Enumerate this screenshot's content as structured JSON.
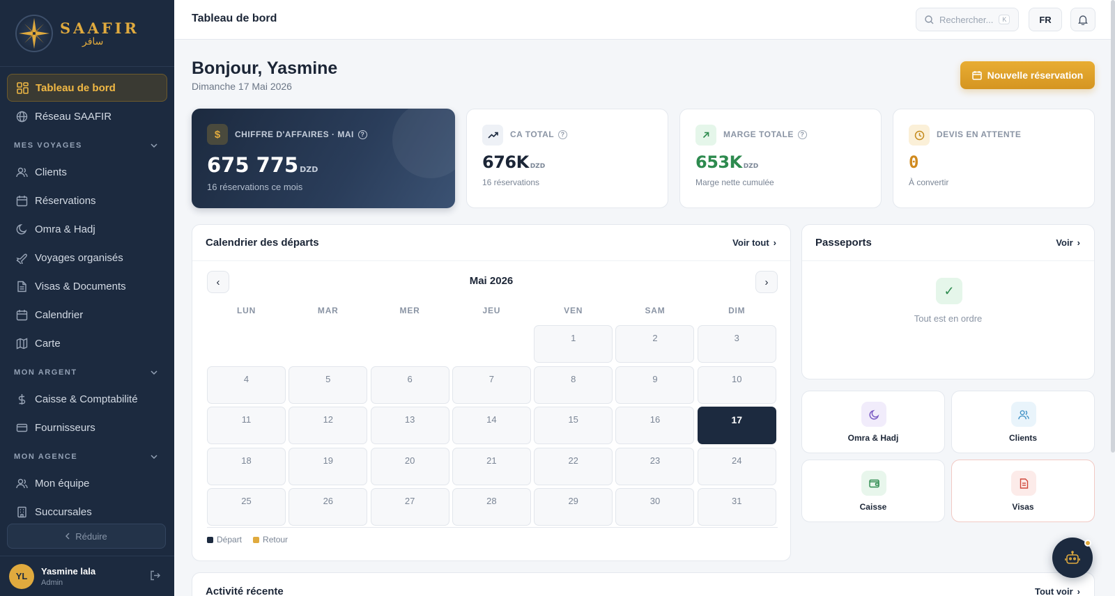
{
  "brand": {
    "name": "SAAFIR",
    "arabic": "سافر"
  },
  "sidebar": {
    "top_items": [
      {
        "label": "Tableau de bord",
        "icon": "dashboard-grid-icon",
        "active": true
      },
      {
        "label": "Réseau SAAFIR",
        "icon": "globe-icon"
      }
    ],
    "sections": [
      {
        "title": "MES VOYAGES",
        "items": [
          {
            "label": "Clients",
            "icon": "users-icon"
          },
          {
            "label": "Réservations",
            "icon": "calendar-icon"
          },
          {
            "label": "Omra & Hadj",
            "icon": "moon-icon"
          },
          {
            "label": "Voyages organisés",
            "icon": "plane-icon"
          },
          {
            "label": "Visas & Documents",
            "icon": "document-icon"
          },
          {
            "label": "Calendrier",
            "icon": "calendar-icon"
          },
          {
            "label": "Carte",
            "icon": "map-icon"
          }
        ]
      },
      {
        "title": "MON ARGENT",
        "items": [
          {
            "label": "Caisse & Comptabilité",
            "icon": "dollar-icon"
          },
          {
            "label": "Fournisseurs",
            "icon": "credit-card-icon"
          }
        ]
      },
      {
        "title": "MON AGENCE",
        "items": [
          {
            "label": "Mon équipe",
            "icon": "users-icon"
          },
          {
            "label": "Succursales",
            "icon": "building-icon"
          }
        ]
      }
    ],
    "reduce_label": "Réduire",
    "user": {
      "initials": "YL",
      "name": "Yasmine lala",
      "role": "Admin"
    }
  },
  "topbar": {
    "title": "Tableau de bord",
    "search_placeholder": "Rechercher...",
    "search_shortcut": "K",
    "lang": "FR"
  },
  "main": {
    "greeting": "Bonjour, Yasmine",
    "date": "Dimanche 17 Mai 2026",
    "new_button": "Nouvelle réservation"
  },
  "kpis": [
    {
      "label": "CHIFFRE D'AFFAIRES · MAI",
      "value": "675 775",
      "unit": "DZD",
      "sub": "16 réservations ce mois",
      "icon": "dollar-icon"
    },
    {
      "label": "CA TOTAL",
      "value": "676K",
      "unit": "DZD",
      "sub": "16 réservations",
      "icon": "trending-up-icon"
    },
    {
      "label": "MARGE TOTALE",
      "value": "653K",
      "unit": "DZD",
      "sub": "Marge nette cumulée",
      "icon": "arrow-up-right-icon"
    },
    {
      "label": "DEVIS EN ATTENTE",
      "value": "0",
      "unit": "",
      "sub": "À convertir",
      "icon": "clock-icon"
    }
  ],
  "calendar": {
    "title": "Calendrier des départs",
    "link": "Voir tout",
    "month": "Mai 2026",
    "weekdays": [
      "LUN",
      "MAR",
      "MER",
      "JEU",
      "VEN",
      "SAM",
      "DIM"
    ],
    "leading_blanks": 4,
    "days": 31,
    "today": 17,
    "legend": [
      {
        "label": "Départ",
        "color": "#1c2a3f"
      },
      {
        "label": "Retour",
        "color": "#e0aa3e"
      }
    ]
  },
  "passports": {
    "title": "Passeports",
    "link": "Voir",
    "status": "Tout est en ordre"
  },
  "quick_tiles": [
    {
      "label": "Omra & Hadj",
      "icon": "moon-icon",
      "color": "#7b5cc4"
    },
    {
      "label": "Clients",
      "icon": "users-icon",
      "color": "#3a8ec4"
    },
    {
      "label": "Caisse",
      "icon": "wallet-icon",
      "color": "#2d8a4e"
    },
    {
      "label": "Visas",
      "icon": "document-icon",
      "color": "#d0473a"
    }
  ],
  "activity": {
    "title": "Activité récente",
    "link": "Tout voir"
  },
  "colors": {
    "accent": "#e0aa3e",
    "navy": "#1c2a3f",
    "success": "#2d8a4e",
    "background": "#f4f6f9"
  }
}
